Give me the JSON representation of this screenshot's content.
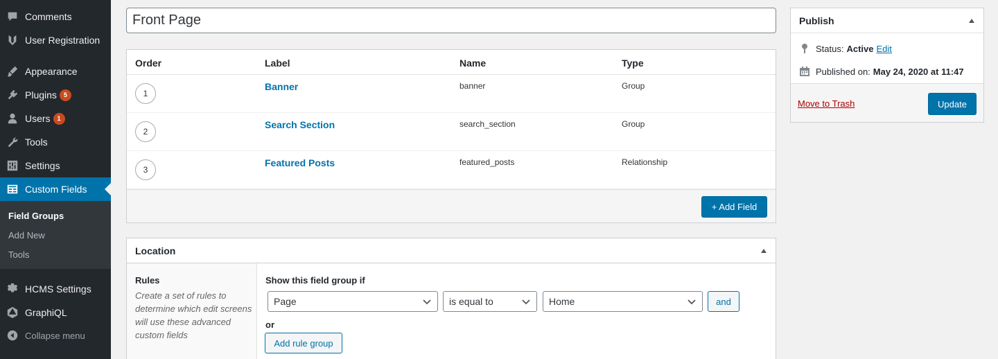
{
  "sidebar": {
    "items": [
      {
        "label": "Comments",
        "icon": "comment-icon"
      },
      {
        "label": "User Registration",
        "icon": "user-registration-icon"
      },
      {
        "label": "Appearance",
        "icon": "paintbrush-icon"
      },
      {
        "label": "Plugins",
        "icon": "plugin-icon",
        "badge": "5"
      },
      {
        "label": "Users",
        "icon": "users-icon",
        "badge": "1"
      },
      {
        "label": "Tools",
        "icon": "wrench-icon"
      },
      {
        "label": "Settings",
        "icon": "settings-icon"
      },
      {
        "label": "Custom Fields",
        "icon": "custom-fields-icon",
        "active": true
      },
      {
        "label": "HCMS Settings",
        "icon": "gear-icon"
      },
      {
        "label": "GraphiQL",
        "icon": "graphql-icon"
      },
      {
        "label": "Collapse menu",
        "icon": "collapse-icon"
      }
    ],
    "submenu": {
      "field_groups": "Field Groups",
      "add_new": "Add New",
      "tools": "Tools"
    }
  },
  "title": {
    "value": "Front Page"
  },
  "fields": {
    "headers": {
      "order": "Order",
      "label": "Label",
      "name": "Name",
      "type": "Type"
    },
    "rows": [
      {
        "order": "1",
        "label": "Banner",
        "name": "banner",
        "type": "Group"
      },
      {
        "order": "2",
        "label": "Search Section",
        "name": "search_section",
        "type": "Group"
      },
      {
        "order": "3",
        "label": "Featured Posts",
        "name": "featured_posts",
        "type": "Relationship"
      }
    ],
    "add_field_label": "+ Add Field"
  },
  "location": {
    "title": "Location",
    "rules_label": "Rules",
    "rules_description": "Create a set of rules to determine which edit screens will use these advanced custom fields",
    "show_if": "Show this field group if",
    "param": "Page",
    "operator": "is equal to",
    "value": "Home",
    "and_label": "and",
    "or_label": "or",
    "add_rule_group_label": "Add rule group"
  },
  "publish": {
    "title": "Publish",
    "status_label": "Status:",
    "status_value": "Active",
    "edit_label": "Edit",
    "published_label": "Published on:",
    "published_value": "May 24, 2020 at 11:47",
    "trash_label": "Move to Trash",
    "update_label": "Update"
  },
  "colors": {
    "accent": "#0073aa",
    "sidebar_bg": "#23282d",
    "badge": "#ca4a1f",
    "danger": "#aa0000"
  }
}
